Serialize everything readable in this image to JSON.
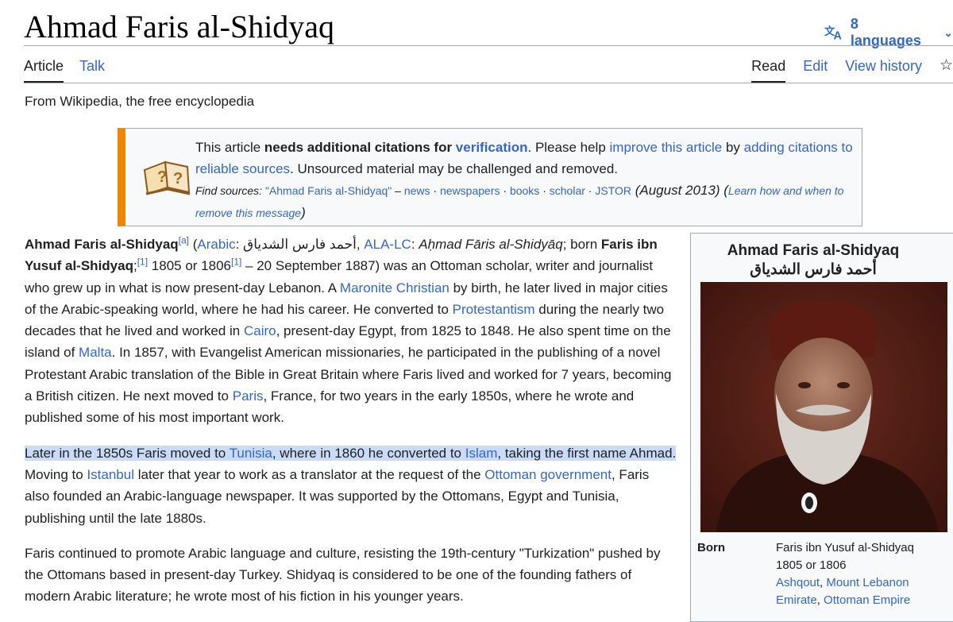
{
  "page": {
    "title": "Ahmad Faris al-Shidyaq",
    "languages_label": "8 languages",
    "tagline": "From Wikipedia, the free encyclopedia"
  },
  "tabs": {
    "article": "Article",
    "talk": "Talk",
    "read": "Read",
    "edit": "Edit",
    "view_history": "View history"
  },
  "notice": {
    "p1": "This article ",
    "p2_bold": "needs additional citations for ",
    "p3_link": "verification",
    "p4": ". Please help ",
    "p5_link": "improve this article",
    "p6": " by ",
    "p7_link": "adding citations to reliable sources",
    "p8": ". Unsourced material may be challenged and removed.",
    "find_sources": "Find sources: ",
    "query": "\"Ahmad Faris al-Shidyaq\"",
    "dash": " – ",
    "src_news": "news",
    "src_newspapers": "newspapers",
    "src_books": "books",
    "src_scholar": "scholar",
    "src_jstor": "JSTOR",
    "sep": " · ",
    "date": " (August 2013)",
    "learn_open": " (",
    "learn": "Learn how and when to remove this message",
    "learn_close": ")"
  },
  "article": {
    "para1": {
      "name_bold": "Ahmad Faris al-Shidyaq",
      "note_a": "[a]",
      "open": " (",
      "arabic_link": "Arabic",
      "colon1": ": ",
      "arabic_name": "أحمد فارس الشدياق",
      "comma1": ", ",
      "alalc_link": "ALA-LC",
      "colon2": ": ",
      "translit": "Aḥmad Fāris al-Shidyāq",
      "born": "; born ",
      "born_name_bold": "Faris ibn Yusuf al-Shidyaq",
      "semi": ";",
      "ref1": "[1]",
      "years": " 1805 or 1806",
      "ref1b": "[1]",
      "t1": " – 20 September 1887) was an Ottoman scholar, writer and journalist who grew up in what is now present-day Lebanon. A ",
      "maronite": "Maronite Christian",
      "t2": " by birth, he later lived in major cities of the Arabic-speaking world, where he had his career. He converted to ",
      "protestantism": "Protestantism",
      "t3": " during the nearly two decades that he lived and worked in ",
      "cairo": "Cairo",
      "t4": ", present-day Egypt, from 1825 to 1848. He also spent time on the island of ",
      "malta": "Malta",
      "t5": ". In 1857, with Evangelist American missionaries, he participated in the publishing of a novel Protestant Arabic translation of the Bible in Great Britain where Faris lived and worked for 7 years, becoming a British citizen. He next moved to ",
      "paris": "Paris",
      "t6": ", France, for two years in the early 1850s, where he wrote and published some of his most important work."
    },
    "para2": {
      "h1": "Later in the 1850s Faris moved to ",
      "tunisia": "Tunisia",
      "h2": ", where in 1860 he converted to ",
      "islam": "Islam",
      "h3": ", taking the first name Ahmad.",
      "t1": " Moving to ",
      "istanbul": "Istanbul",
      "t2": " later that year to work as a translator at the request of the ",
      "ottoman_gov": "Ottoman government",
      "t3": ", Faris also founded an Arabic-language newspaper. It was supported by the Ottomans, Egypt and Tunisia, publishing until the late 1880s."
    },
    "para3": {
      "text": "Faris continued to promote Arabic language and culture, resisting the 19th-century \"Turkization\" pushed by the Ottomans based in present-day Turkey. Shidyaq is considered to be one of the founding fathers of modern Arabic literature; he wrote most of his fiction in his younger years."
    }
  },
  "infobox": {
    "title": "Ahmad Faris al-Shidyaq",
    "arabic": "أحمد فارس الشدياق",
    "born_label": "Born",
    "born_name": "Faris ibn Yusuf al-Shidyaq",
    "born_year": "1805 or 1806",
    "place1": "Ashqout",
    "comma": ", ",
    "place2": "Mount Lebanon Emirate",
    "comma2": ", ",
    "place3": "Ottoman Empire"
  },
  "icons": {
    "language": "translate-icon",
    "chevron": "chevron-down-icon",
    "watch": "star-icon",
    "notice": "book-question-icon"
  },
  "colors": {
    "link": "#3366cc",
    "notice_accent": "#f28500",
    "highlight": "#c9dbf7"
  }
}
